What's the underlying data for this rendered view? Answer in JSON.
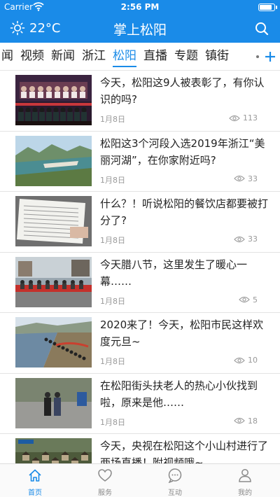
{
  "status_bar": {
    "carrier": "Carrier",
    "time": "2:56 PM",
    "battery_level": 0.9
  },
  "header": {
    "temperature": "22°C",
    "title": "掌上松阳",
    "weather_icon": "sun-icon",
    "search_icon": "search-icon"
  },
  "tabs": {
    "items": [
      "闻",
      "视频",
      "新闻",
      "浙江",
      "松阳",
      "直播",
      "专题",
      "镇街"
    ],
    "active": "松阳",
    "add_icon": "plus-icon"
  },
  "news": [
    {
      "title": "今天，松阳这9人被表彰了，有你认识的吗?",
      "date": "1月8日",
      "views": "113"
    },
    {
      "title": "松阳这3个河段入选2019年浙江“美丽河湖”，在你家附近吗?",
      "date": "1月8日",
      "views": "33"
    },
    {
      "title": "什么？！听说松阳的餐饮店都要被打分了?",
      "date": "1月8日",
      "views": "33"
    },
    {
      "title": "今天腊八节，这里发生了暖心一幕……",
      "date": "1月8日",
      "views": "5"
    },
    {
      "title": "2020来了！今天，松阳市民这样欢度元旦~",
      "date": "1月8日",
      "views": "10"
    },
    {
      "title": "在松阳街头扶老人的热心小伙找到啦，原来是他……",
      "date": "1月8日",
      "views": "18"
    },
    {
      "title": "今天，央视在松阳这个小山村进行了两场直播！附视频哦~",
      "date": "",
      "views": ""
    }
  ],
  "bottom_nav": [
    {
      "label": "首页",
      "icon": "home-icon",
      "active": true
    },
    {
      "label": "服务",
      "icon": "heart-icon",
      "active": false
    },
    {
      "label": "互动",
      "icon": "chat-icon",
      "active": false
    },
    {
      "label": "我的",
      "icon": "user-icon",
      "active": false
    }
  ],
  "colors": {
    "brand": "#1a8be8",
    "meta_text": "#999999",
    "divider": "#e3e3e3"
  }
}
